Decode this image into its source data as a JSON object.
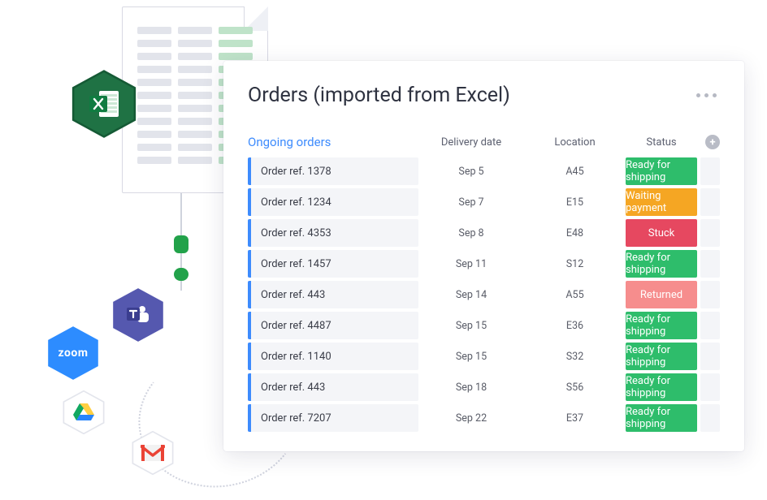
{
  "card": {
    "title": "Orders (imported from Excel)",
    "section_label": "Ongoing orders",
    "columns": {
      "delivery": "Delivery date",
      "location": "Location",
      "status": "Status"
    },
    "rows": [
      {
        "ref": "Order ref. 1378",
        "date": "Sep 5",
        "loc": "A45",
        "status": "Ready for shipping",
        "color": "#2ebd6b"
      },
      {
        "ref": "Order ref. 1234",
        "date": "Sep 7",
        "loc": "E15",
        "status": "Waiting payment",
        "color": "#f5a623"
      },
      {
        "ref": "Order ref. 4353",
        "date": "Sep 8",
        "loc": "E48",
        "status": "Stuck",
        "color": "#e64860"
      },
      {
        "ref": "Order ref. 1457",
        "date": "Sep 11",
        "loc": "S12",
        "status": "Ready for shipping",
        "color": "#2ebd6b"
      },
      {
        "ref": "Order ref. 443",
        "date": "Sep 14",
        "loc": "A55",
        "status": "Returned",
        "color": "#f68d8d"
      },
      {
        "ref": "Order ref. 4487",
        "date": "Sep 15",
        "loc": "E36",
        "status": "Ready for shipping",
        "color": "#2ebd6b"
      },
      {
        "ref": "Order ref. 1140",
        "date": "Sep 15",
        "loc": "S32",
        "status": "Ready for shipping",
        "color": "#2ebd6b"
      },
      {
        "ref": "Order ref. 443",
        "date": "Sep 18",
        "loc": "S56",
        "status": "Ready for shipping",
        "color": "#2ebd6b"
      },
      {
        "ref": "Order ref. 7207",
        "date": "Sep 22",
        "loc": "E37",
        "status": "Ready for shipping",
        "color": "#2ebd6b"
      }
    ]
  },
  "badges": {
    "excel": "X",
    "zoom": "zoom"
  }
}
